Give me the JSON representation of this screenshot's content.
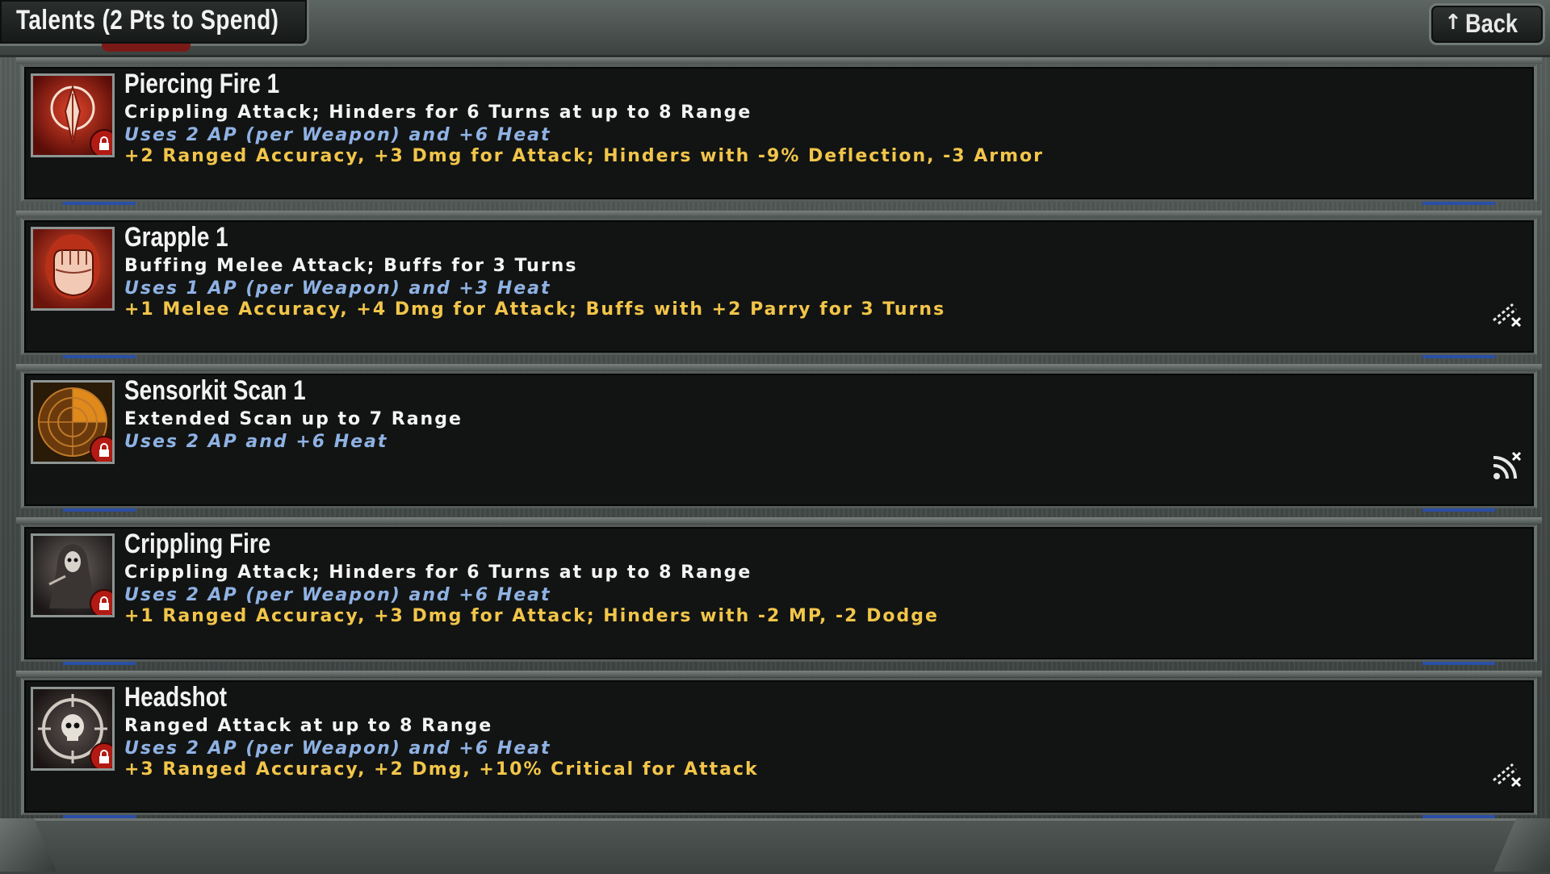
{
  "header": {
    "title": "Talents (2 Pts to Spend)",
    "back_arrow": "↑",
    "back_label": "Back"
  },
  "talents": [
    {
      "name": "Piercing Fire 1",
      "line1": "Crippling Attack; Hinders for 6 Turns at up to 8 Range",
      "line2": "Uses 2 AP (per Weapon) and +6 Heat",
      "line3": "+2 Ranged Accuracy, +3 Dmg for Attack; Hinders with -9% Deflection, -3 Armor",
      "icon": "piercing-bullet-icon",
      "locked": true,
      "side_icon": null
    },
    {
      "name": "Grapple 1",
      "line1": "Buffing Melee Attack; Buffs for 3 Turns",
      "line2": "Uses 1 AP (per Weapon) and +3 Heat",
      "line3": "+1 Melee Accuracy, +4 Dmg for Attack; Buffs with +2 Parry for 3 Turns",
      "icon": "fist-icon",
      "locked": false,
      "side_icon": "weapon-disabled-icon"
    },
    {
      "name": "Sensorkit Scan 1",
      "line1": "Extended Scan up to 7 Range",
      "line2": "Uses 2 AP and +6 Heat",
      "line3": "",
      "icon": "radar-icon",
      "locked": true,
      "side_icon": "scan-disabled-icon"
    },
    {
      "name": "Crippling Fire",
      "line1": "Crippling Attack; Hinders for 6 Turns at up to 8 Range",
      "line2": "Uses 2 AP (per Weapon) and +6 Heat",
      "line3": "+1 Ranged Accuracy, +3 Dmg for Attack; Hinders with -2 MP, -2 Dodge",
      "icon": "reaper-icon",
      "locked": true,
      "side_icon": null
    },
    {
      "name": "Headshot",
      "line1": "Ranged Attack at up to 8 Range",
      "line2": "Uses 2 AP (per Weapon) and +6 Heat",
      "line3": "+3 Ranged Accuracy, +2 Dmg, +10% Critical for Attack",
      "icon": "skull-crosshair-icon",
      "locked": true,
      "side_icon": "weapon-disabled-icon"
    }
  ],
  "colors": {
    "name": "#f2f2f2",
    "desc": "#f4f4f4",
    "cost": "#8fb2e4",
    "bonus": "#f2c54a",
    "lock": "#b21a14",
    "accent_blue": "#2a4fa6"
  }
}
